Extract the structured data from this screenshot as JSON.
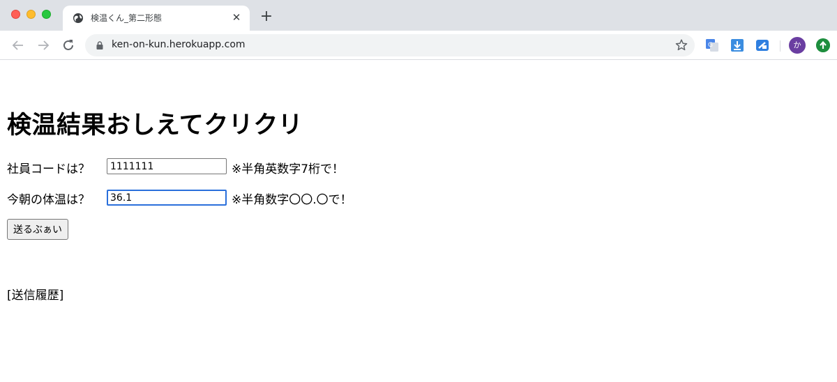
{
  "browser": {
    "tab": {
      "title": "検温くん_第二形態",
      "close": "✕"
    },
    "new_tab": "+",
    "url": "ken-on-kun.herokuapp.com",
    "avatar_initial": "か",
    "colors": {
      "tabstrip": "#dee1e6",
      "avatar": "#6a3ea1",
      "update": "#1e8e3e"
    }
  },
  "page": {
    "title": "検温結果おしえてクリクリ",
    "employee": {
      "label": "社員コードは？",
      "value": "1111111",
      "note": "※半角英数字7桁で！"
    },
    "temperature": {
      "label": "今朝の体温は？",
      "value": "36.1",
      "note": "※半角数字〇〇.〇で！"
    },
    "submit_label": "送るぶぁい",
    "history_label": "[送信履歴]"
  }
}
